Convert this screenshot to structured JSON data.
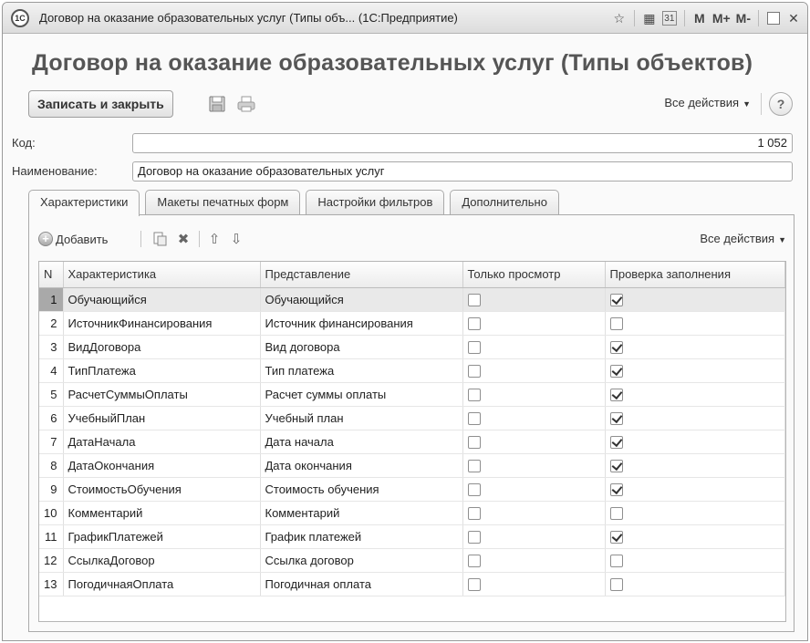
{
  "window": {
    "title": "Договор на оказание образовательных услуг (Типы объ...  (1С:Предприятие)",
    "logo_text": "1С",
    "controls": [
      "M",
      "M+",
      "M-"
    ],
    "star_glyph": "☆",
    "calc_glyph": "▦",
    "cal_glyph": "31",
    "close_glyph": "✕"
  },
  "form": {
    "title": "Договор на оказание образовательных услуг (Типы объектов)"
  },
  "toolbar": {
    "save_close_label": "Записать и закрыть",
    "all_actions_label": "Все действия",
    "help_label": "?"
  },
  "fields": {
    "code_label": "Код:",
    "code_value": "1 052",
    "name_label": "Наименование:",
    "name_value": "Договор на оказание образовательных услуг"
  },
  "tabs": [
    {
      "label": "Характеристики",
      "active": true
    },
    {
      "label": "Макеты печатных форм",
      "active": false
    },
    {
      "label": "Настройки фильтров",
      "active": false
    },
    {
      "label": "Дополнительно",
      "active": false
    }
  ],
  "table_toolbar": {
    "add_label": "Добавить",
    "all_actions_label": "Все действия"
  },
  "table": {
    "columns": [
      "N",
      "Характеристика",
      "Представление",
      "Только просмотр",
      "Проверка заполнения"
    ],
    "selected_row": 1,
    "rows": [
      {
        "n": "1",
        "characteristic": "Обучающийся",
        "representation": "Обучающийся",
        "view_only": false,
        "check_fill": true
      },
      {
        "n": "2",
        "characteristic": "ИсточникФинансирования",
        "representation": "Источник финансирования",
        "view_only": false,
        "check_fill": false
      },
      {
        "n": "3",
        "characteristic": "ВидДоговора",
        "representation": "Вид договора",
        "view_only": false,
        "check_fill": true
      },
      {
        "n": "4",
        "characteristic": "ТипПлатежа",
        "representation": "Тип платежа",
        "view_only": false,
        "check_fill": true
      },
      {
        "n": "5",
        "characteristic": "РасчетСуммыОплаты",
        "representation": "Расчет суммы оплаты",
        "view_only": false,
        "check_fill": true
      },
      {
        "n": "6",
        "characteristic": "УчебныйПлан",
        "representation": "Учебный план",
        "view_only": false,
        "check_fill": true
      },
      {
        "n": "7",
        "characteristic": "ДатаНачала",
        "representation": "Дата начала",
        "view_only": false,
        "check_fill": true
      },
      {
        "n": "8",
        "characteristic": "ДатаОкончания",
        "representation": "Дата окончания",
        "view_only": false,
        "check_fill": true
      },
      {
        "n": "9",
        "characteristic": "СтоимостьОбучения",
        "representation": "Стоимость обучения",
        "view_only": false,
        "check_fill": true
      },
      {
        "n": "10",
        "characteristic": "Комментарий",
        "representation": "Комментарий",
        "view_only": false,
        "check_fill": false
      },
      {
        "n": "11",
        "characteristic": "ГрафикПлатежей",
        "representation": "График платежей",
        "view_only": false,
        "check_fill": true
      },
      {
        "n": "12",
        "characteristic": "СсылкаДоговор",
        "representation": "Ссылка договор",
        "view_only": false,
        "check_fill": false
      },
      {
        "n": "13",
        "characteristic": "ПогодичнаяОплата",
        "representation": "Погодичная оплата",
        "view_only": false,
        "check_fill": false
      }
    ]
  }
}
